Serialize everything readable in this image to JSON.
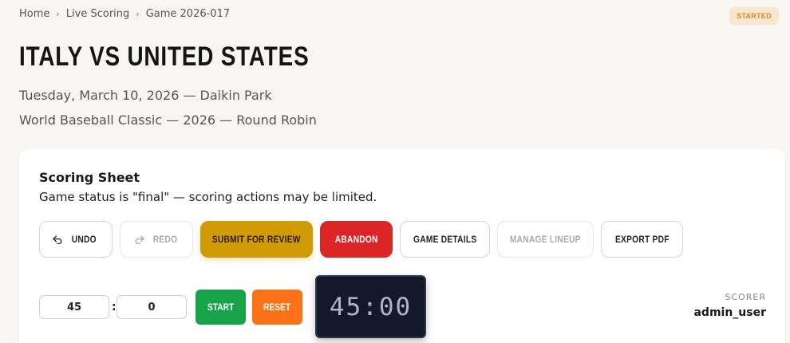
{
  "breadcrumb": {
    "home": "Home",
    "section": "Live Scoring",
    "current": "Game 2026-017",
    "separator": "›"
  },
  "status_badge": "STARTED",
  "game": {
    "title": "ITALY VS UNITED STATES",
    "date_venue": "Tuesday, March 10, 2026 — Daikin Park",
    "event": "World Baseball Classic — 2026 — Round Robin"
  },
  "scoring_sheet": {
    "title": "Scoring Sheet",
    "status_note": "Game status is \"final\" — scoring actions may be limited.",
    "toolbar": {
      "undo": "UNDO",
      "redo": "REDO",
      "submit": "SUBMIT FOR REVIEW",
      "abandon": "ABANDON",
      "details": "GAME DETAILS",
      "lineup": "MANAGE LINEUP",
      "export": "EXPORT PDF"
    },
    "timer": {
      "minutes": "45",
      "seconds": "0",
      "colon": ":",
      "start_label": "START",
      "reset_label": "RESET",
      "display": "45:00"
    },
    "scorer": {
      "label": "SCORER",
      "name": "admin_user"
    }
  },
  "colors": {
    "submit": "#d19a07",
    "abandon": "#dc2626",
    "start": "#16a34a",
    "reset": "#f97316",
    "clock_bg": "#121a2a",
    "badge_bg": "#f8e6cf",
    "badge_text": "#d48a2a"
  },
  "icons": {
    "undo": "undo-arrow-icon",
    "redo": "redo-arrow-icon"
  }
}
